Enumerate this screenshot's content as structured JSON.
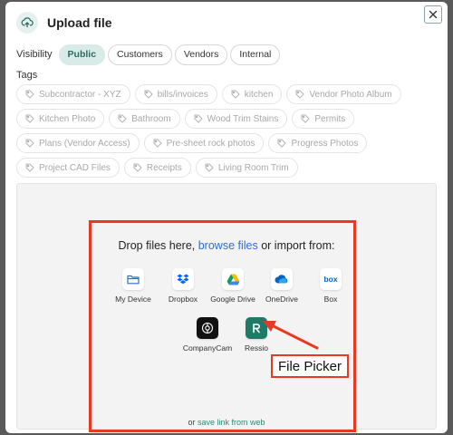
{
  "modal": {
    "title": "Upload file",
    "upload_icon": "cloud-upload-icon",
    "close_icon": "close-icon"
  },
  "visibility": {
    "label": "Visibility",
    "options": [
      "Public",
      "Customers",
      "Vendors",
      "Internal"
    ],
    "selected": "Public"
  },
  "tags": {
    "label": "Tags",
    "tag_icon": "tag-icon",
    "items": [
      "Subcontractor - XYZ",
      "bills/invoices",
      "kitchen",
      "Vendor Photo Album",
      "Kitchen Photo",
      "Bathroom",
      "Wood Trim Stains",
      "Permits",
      "Plans (Vendor Access)",
      "Pre-sheet rock photos",
      "Progress Photos",
      "Project CAD Files",
      "Receipts",
      "Living Room Trim"
    ]
  },
  "dropzone": {
    "text_before": "Drop files here, ",
    "browse_link": "browse files",
    "text_after": " or import from:",
    "sources": [
      {
        "label": "My Device",
        "icon": "folder-icon"
      },
      {
        "label": "Dropbox",
        "icon": "dropbox-icon"
      },
      {
        "label": "Google Drive",
        "icon": "google-drive-icon"
      },
      {
        "label": "OneDrive",
        "icon": "onedrive-icon"
      },
      {
        "label": "Box",
        "icon": "box-icon"
      },
      {
        "label": "CompanyCam",
        "icon": "companycam-icon"
      },
      {
        "label": "Ressio",
        "icon": "ressio-icon"
      }
    ],
    "footer_prefix": "or ",
    "footer_link": "save link from web"
  },
  "annotation": {
    "callout": "File Picker",
    "color": "#e63a23"
  },
  "colors": {
    "accent": "#2d6a5f",
    "link": "#2f6fcf"
  }
}
